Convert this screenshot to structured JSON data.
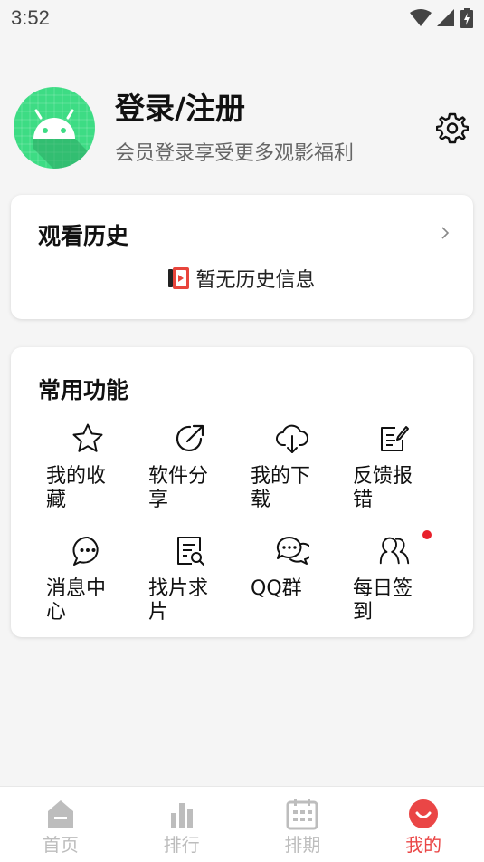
{
  "status_bar": {
    "time": "3:52"
  },
  "profile": {
    "title": "登录/注册",
    "subtitle": "会员登录享受更多观影福利",
    "avatar_icon": "android-robot-icon",
    "settings_icon": "gear-icon"
  },
  "history": {
    "title": "观看历史",
    "empty_text": "暂无历史信息",
    "arrow_icon": "chevron-right-icon"
  },
  "functions": {
    "title": "常用功能",
    "items": [
      {
        "label": "我的收藏",
        "icon": "star-icon"
      },
      {
        "label": "软件分享",
        "icon": "share-icon"
      },
      {
        "label": "我的下载",
        "icon": "cloud-download-icon"
      },
      {
        "label": "反馈报错",
        "icon": "edit-icon"
      },
      {
        "label": "消息中心",
        "icon": "message-icon"
      },
      {
        "label": "找片求片",
        "icon": "document-search-icon"
      },
      {
        "label": "QQ群",
        "icon": "chat-bubbles-icon"
      },
      {
        "label": "每日签到",
        "icon": "users-icon"
      }
    ]
  },
  "bottom_nav": {
    "items": [
      {
        "label": "首页",
        "icon": "home-icon"
      },
      {
        "label": "排行",
        "icon": "ranking-icon"
      },
      {
        "label": "排期",
        "icon": "calendar-icon"
      },
      {
        "label": "我的",
        "icon": "profile-icon"
      }
    ],
    "active_index": 3,
    "active_color": "#ea4646",
    "inactive_color": "#bdbdbd"
  },
  "colors": {
    "accent": "#ea4646",
    "avatar_bg": "#3ddc84",
    "red_dot": "#e8202b"
  }
}
